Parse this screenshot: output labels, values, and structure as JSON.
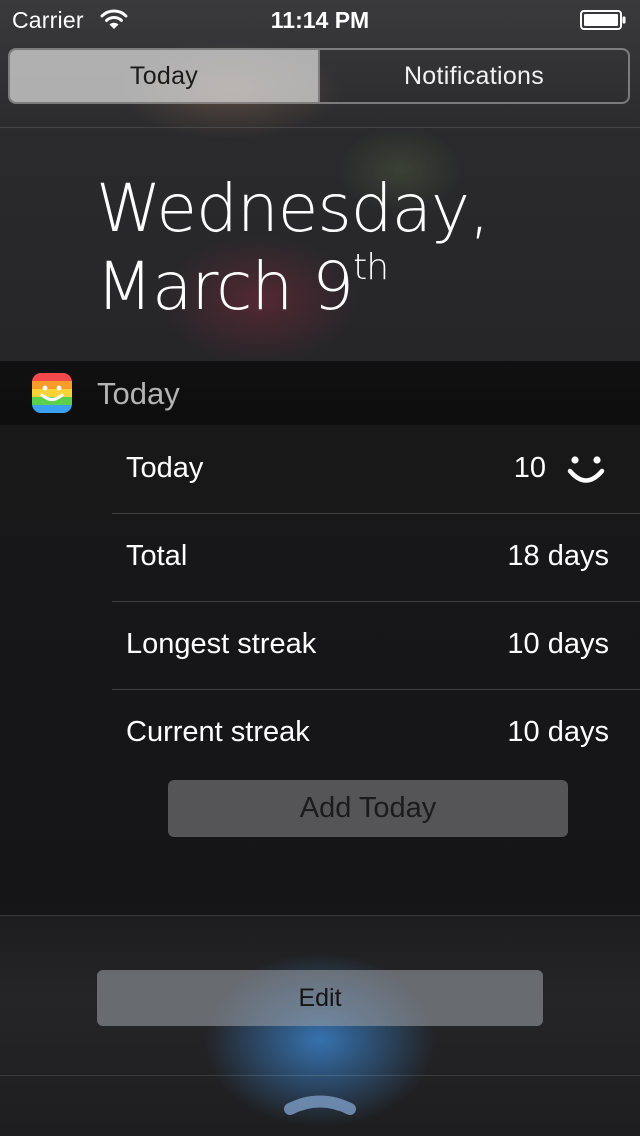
{
  "status_bar": {
    "carrier": "Carrier",
    "time": "11:14 PM",
    "wifi_icon": "wifi-icon",
    "battery_icon": "battery-icon"
  },
  "tabs": [
    {
      "label": "Today",
      "selected": true
    },
    {
      "label": "Notifications",
      "selected": false
    }
  ],
  "date": {
    "line1": "Wednesday,",
    "line2": "March 9",
    "suffix": "th"
  },
  "widget": {
    "icon": "rainbow-smiley-app-icon",
    "title": "Today",
    "stats": [
      {
        "label": "Today",
        "value": "10",
        "icon": "smiley-icon"
      },
      {
        "label": "Total",
        "value": "18 days"
      },
      {
        "label": "Longest streak",
        "value": "10 days"
      },
      {
        "label": "Current streak",
        "value": "10 days"
      }
    ],
    "add_button": "Add Today"
  },
  "edit_button": "Edit",
  "grabber_icon": "chevron-up-grabber-icon",
  "colors": {
    "icon_stripes": [
      "#f5484a",
      "#f79c2b",
      "#f7d336",
      "#5dcf4f",
      "#3aa0f0"
    ],
    "selected_tab_bg": "#e1e1e1",
    "edit_glow": "#3c8cdc"
  }
}
